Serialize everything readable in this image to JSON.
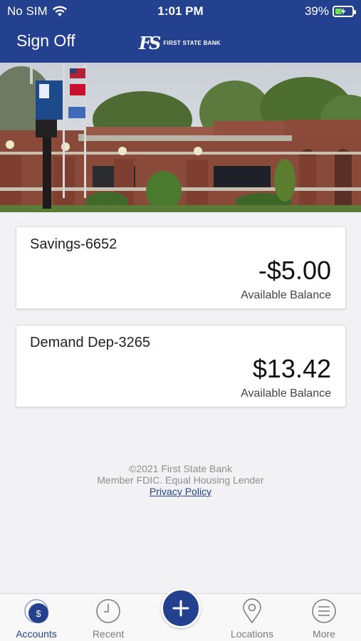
{
  "status_bar": {
    "carrier": "No SIM",
    "time": "1:01 PM",
    "battery_percent": "39%",
    "battery_level": 0.39
  },
  "header": {
    "sign_off_label": "Sign Off",
    "bank_name": "FIRST STATE BANK",
    "logo_mark": "FS",
    "brand_color": "#24418f"
  },
  "accounts": [
    {
      "name": "Savings-6652",
      "balance": "-$5.00",
      "balance_label": "Available Balance"
    },
    {
      "name": "Demand Dep-3265",
      "balance": "$13.42",
      "balance_label": "Available Balance"
    }
  ],
  "footer": {
    "copyright": "©2021 First State Bank",
    "member": "Member FDIC. Equal Housing Lender",
    "privacy_link": "Privacy Policy"
  },
  "tabbar": {
    "accounts": "Accounts",
    "recent": "Recent",
    "add": "+",
    "locations": "Locations",
    "more": "More",
    "accounts_icon_glyph": "$"
  }
}
